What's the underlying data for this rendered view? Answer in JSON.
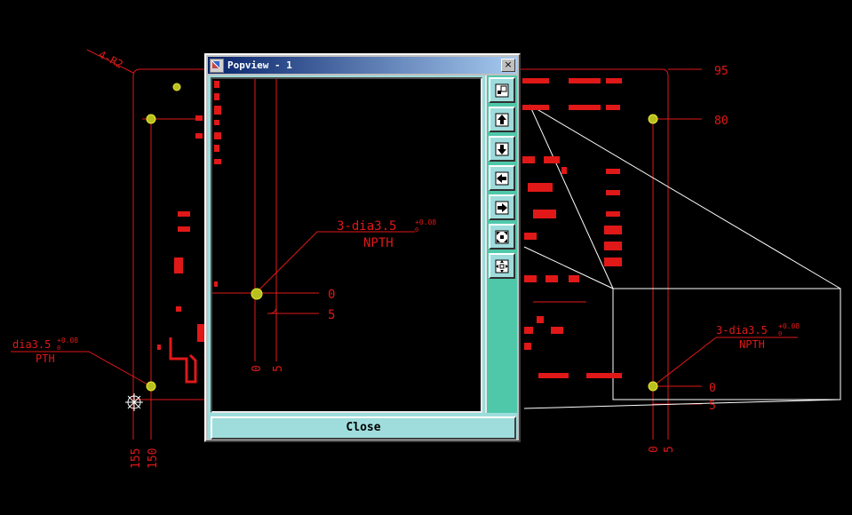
{
  "window": {
    "title": "Popview - 1",
    "close_glyph": "×"
  },
  "canvas": {
    "dims_right": [
      "95",
      "80",
      "0",
      "5"
    ],
    "dims_bottom": [
      "155",
      "150",
      "0",
      "5"
    ],
    "radius_label": "4-R2",
    "pth_label": {
      "main": "dia3.5",
      "tol": "+0.08",
      "tol_lower": "0",
      "sub": "PTH"
    },
    "npth_label": {
      "main": "3-dia3.5",
      "tol": "+0.08",
      "tol_lower": "0",
      "sub": "NPTH"
    }
  },
  "popview": {
    "dims_right": [
      "0",
      "5"
    ],
    "dims_bottom": [
      "0",
      "5"
    ],
    "npth_label": {
      "main": "3-dia3.5",
      "tol": "+0.08",
      "tol_lower": "0",
      "sub": "NPTH"
    }
  },
  "toolbar": {
    "buttons": [
      {
        "name": "zoom-window-button",
        "icon": "zoom-window-icon"
      },
      {
        "name": "pan-up-button",
        "icon": "pan-up-icon"
      },
      {
        "name": "pan-down-button",
        "icon": "pan-down-icon"
      },
      {
        "name": "pan-left-button",
        "icon": "pan-left-icon"
      },
      {
        "name": "pan-right-button",
        "icon": "pan-right-icon"
      },
      {
        "name": "zoom-fit-button",
        "icon": "zoom-fit-icon"
      },
      {
        "name": "pan-all-button",
        "icon": "pan-all-icon"
      }
    ]
  },
  "close_button": {
    "label": "Close"
  },
  "colors": {
    "dimension": "#e01818",
    "pad": "#c8c820",
    "outline": "#ffffff",
    "panel": "#9fdcdc",
    "toolbar": "#4fc8aa",
    "titlebar": "#08246b"
  }
}
